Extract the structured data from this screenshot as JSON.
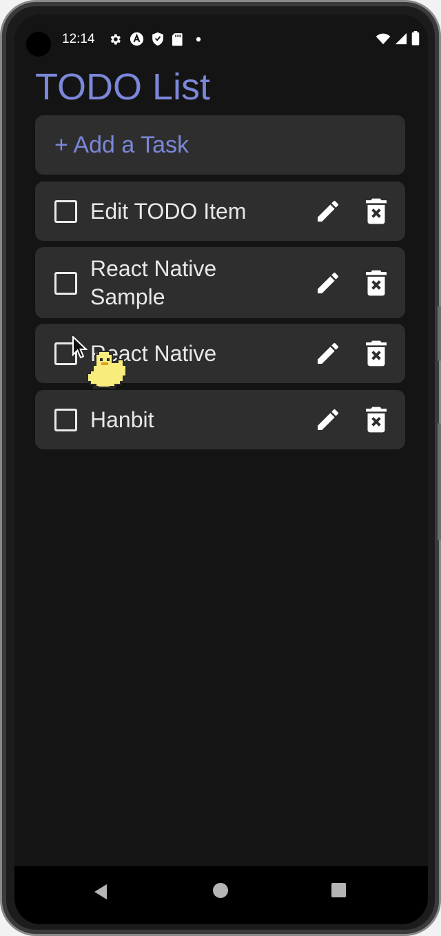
{
  "status_bar": {
    "time": "12:14",
    "left_icons": [
      "gear-icon",
      "a-circle-icon",
      "shield-icon",
      "sd-card-icon",
      "dot-icon"
    ],
    "right_icons": [
      "wifi-icon",
      "signal-icon",
      "battery-icon"
    ]
  },
  "app": {
    "title": "TODO List",
    "add_task_label": "+ Add a Task"
  },
  "todos": [
    {
      "text": "Edit TODO Item",
      "checked": false
    },
    {
      "text": "React Native Sample",
      "checked": false
    },
    {
      "text": "React Native",
      "checked": false
    },
    {
      "text": "Hanbit",
      "checked": false
    }
  ],
  "item_icons": {
    "edit": "pencil-icon",
    "delete": "trash-x-icon"
  },
  "nav_bar": {
    "icons": [
      "back-triangle-icon",
      "home-circle-icon",
      "recents-square-icon"
    ]
  },
  "colors": {
    "accent": "#7b87d8",
    "background": "#141414",
    "card": "#2e2e2e",
    "text": "#e8e8e8"
  }
}
